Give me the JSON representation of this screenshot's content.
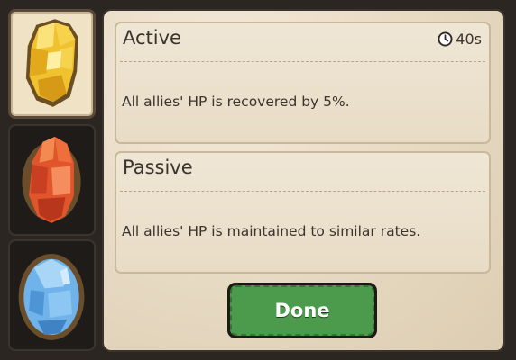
{
  "gems": [
    {
      "name": "gold",
      "selected": true
    },
    {
      "name": "red",
      "selected": false
    },
    {
      "name": "blue",
      "selected": false
    }
  ],
  "active": {
    "title": "Active",
    "cooldown": "40s",
    "description": "All allies' HP is recovered by 5%."
  },
  "passive": {
    "title": "Passive",
    "description": "All allies' HP is maintained to similar rates."
  },
  "done_label": "Done",
  "colors": {
    "button": "#4c9a4b",
    "parchment": "#eadfcb",
    "gold_gem": "#f0c230",
    "red_gem": "#e0552c",
    "blue_gem": "#6fb3ea"
  }
}
